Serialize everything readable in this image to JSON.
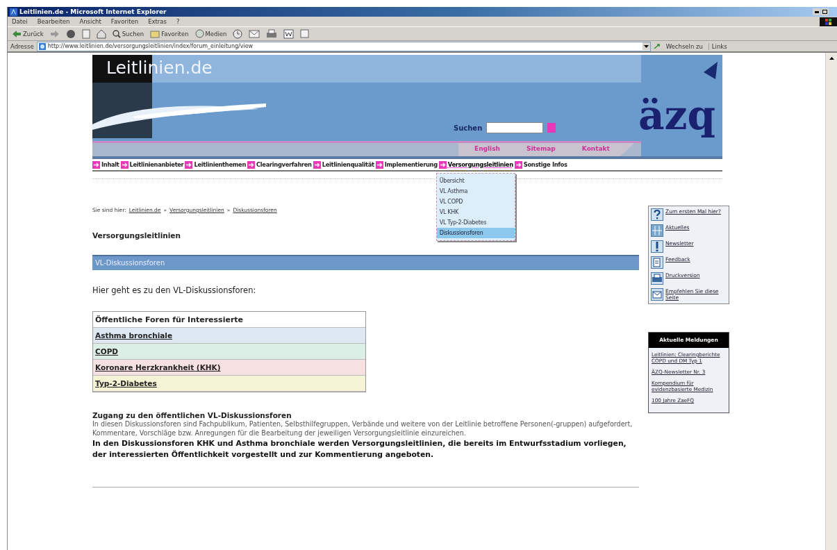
{
  "window": {
    "title": "Leitlinien.de - Microsoft Internet Explorer"
  },
  "menu": [
    "Datei",
    "Bearbeiten",
    "Ansicht",
    "Favoriten",
    "Extras",
    "?"
  ],
  "toolbar": [
    {
      "kind": "back",
      "label": "Zurück"
    },
    {
      "kind": "forward"
    },
    {
      "kind": "stop"
    },
    {
      "kind": "refresh"
    },
    {
      "kind": "home"
    },
    {
      "kind": "search",
      "label": "Suchen"
    },
    {
      "kind": "favorites",
      "label": "Favoriten"
    },
    {
      "kind": "media",
      "label": "Medien"
    },
    {
      "kind": "history"
    },
    {
      "kind": "mail"
    },
    {
      "kind": "print"
    },
    {
      "kind": "edit"
    },
    {
      "kind": "discuss"
    }
  ],
  "address": {
    "label": "Adresse",
    "value": "http://www.leitlinien.de/versorgungsleitlinien/index/forum_einleitung/view",
    "go": "Wechseln zu",
    "links": "Links"
  },
  "banner": {
    "logo": "Leitlinien.de",
    "search_label": "Suchen",
    "brand": "äzq",
    "links": [
      "English",
      "Sitemap",
      "Kontakt"
    ]
  },
  "nav": [
    {
      "label": "Inhalt",
      "expanded": false
    },
    {
      "label": "Leitlinienanbieter",
      "expanded": false
    },
    {
      "label": "Leitlinienthemen",
      "expanded": false
    },
    {
      "label": "Clearingverfahren",
      "expanded": false
    },
    {
      "label": "Leitlinienqualität",
      "expanded": false
    },
    {
      "label": "Implementierung",
      "expanded": false
    },
    {
      "label": "Versorgungsleitlinien",
      "expanded": true,
      "children": [
        {
          "label": "Übersicht",
          "selected": false
        },
        {
          "label": "VL Asthma",
          "selected": false
        },
        {
          "label": "VL COPD",
          "selected": false
        },
        {
          "label": "VL KHK",
          "selected": false
        },
        {
          "label": "VL Typ-2-Diabetes",
          "selected": false
        },
        {
          "label": "Diskussionsforen",
          "selected": true
        }
      ]
    },
    {
      "label": "Sonstige Infos",
      "expanded": false
    }
  ],
  "breadcrumb": {
    "prefix": "Sie sind hier:",
    "items": [
      "Leitlinien.de",
      "Versorgungsleitlinien",
      "Diskussionsforen"
    ],
    "separator": "»"
  },
  "heading": "Versorgungsleitlinien",
  "section_title": "VL-Diskussionsforen",
  "intro": "Hier geht es zu den VL-Diskussionsforen:",
  "forums": {
    "header": "Öffentliche Foren für Interessierte",
    "rows": [
      {
        "label": "Asthma bronchiale",
        "color": "#dde8f3"
      },
      {
        "label": "COPD",
        "color": "#dcefe4"
      },
      {
        "label": "Koronare Herzkrankheit (KHK)",
        "color": "#f7e0e1"
      },
      {
        "label": "Typ-2-Diabetes",
        "color": "#f6f4d6"
      }
    ]
  },
  "access": {
    "title": "Zugang zu den öffentlichen VL-Diskussionsforen",
    "text": "In diesen Diskussionsforen sind Fachpublikum, Patienten, Selbsthilfegruppen, Verbände und weitere von der Leitlinie betroffene Personen(-gruppen) aufgefordert, Kommentare, Vorschläge bzw. Anregungen für die Bearbeitung der jeweiligen Versorgungsleitlinie einzureichen.",
    "note": "In den Diskussionsforen KHK und Asthma bronchiale werden Versorgungsleitlinien, die bereits im Entwurfsstadium vorliegen, der interessierten Öffentlichkeit vorgestellt und zur Kommentierung angeboten."
  },
  "sidebar": [
    {
      "kind": "question",
      "label": "Zum ersten Mal hier?"
    },
    {
      "kind": "grid",
      "label": "Aktuelles"
    },
    {
      "kind": "exclaim",
      "label": "Newsletter"
    },
    {
      "kind": "feedback",
      "label": "Feedback"
    },
    {
      "kind": "print",
      "label": "Druckversion"
    },
    {
      "kind": "recommend",
      "label": "Empfehlen Sie diese Seite"
    }
  ],
  "news": {
    "title": "Aktuelle Meldungen",
    "items": [
      "Leitlinien: Clearingberichte COPD und DM Typ 1",
      "ÄZQ-Newsletter Nr. 3",
      "Kompendium für evidenzbasierte Medizin",
      "100 Jahre ZaeFQ"
    ]
  }
}
